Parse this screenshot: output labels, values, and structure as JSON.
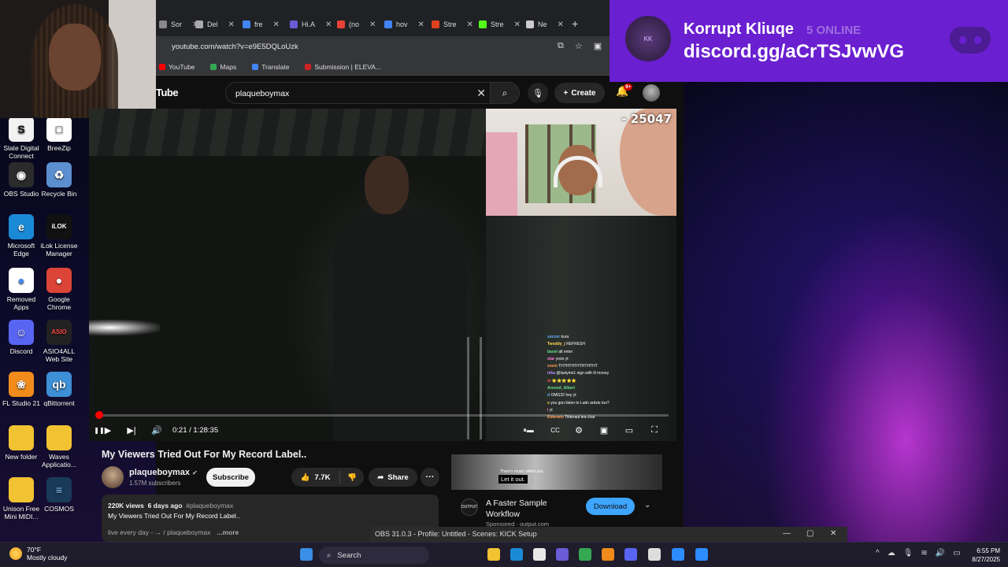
{
  "overlay": {
    "discord_server": "Korrupt Kliuqe",
    "discord_online": "5 ONLINE",
    "discord_link": "discord.gg/aCrTSJvwVG"
  },
  "browser": {
    "tabs": [
      {
        "label": "Sor",
        "color": "#888888"
      },
      {
        "label": "Del",
        "color": "#aaaaaa"
      },
      {
        "label": "fre",
        "color": "#4285f4"
      },
      {
        "label": "Hi.A",
        "color": "#6b5bd6"
      },
      {
        "label": "(no",
        "color": "#ea4335"
      },
      {
        "label": "hov",
        "color": "#4285f4"
      },
      {
        "label": "Stre",
        "color": "#e04020"
      },
      {
        "label": "Stre",
        "color": "#53fc18"
      },
      {
        "label": "Ne",
        "color": "#cccccc"
      }
    ],
    "url": "youtube.com/watch?v=e9E5DQLoUzk",
    "bookmarks": [
      {
        "label": "YouTube",
        "color": "#ff0000"
      },
      {
        "label": "Maps",
        "color": "#34a853"
      },
      {
        "label": "Translate",
        "color": "#4285f4"
      },
      {
        "label": "Submission | ELEVA...",
        "color": "#cc2222"
      }
    ]
  },
  "youtube": {
    "logo": "Tube",
    "search_query": "plaqueboymax",
    "create_label": "Create",
    "notif_count": "9+",
    "stream_counter": "- 25047",
    "time_display": "0:21 / 1:28:35",
    "progress_fraction": 0.004,
    "video_title": "My Viewers Tried Out For My Record Label..",
    "channel_name": "plaqueboymax",
    "subscribers": "1.57M subscribers",
    "subscribe_label": "Subscribe",
    "likes": "7.7K",
    "share_label": "Share",
    "desc_views": "220K views",
    "desc_age": "6 days ago",
    "desc_tag": "#plaqueboymax",
    "desc_line": "My Viewers Tried Out For My Record Label..",
    "desc_more": "...more",
    "desc_trunc": "live every day - → / plaqueboymax",
    "ad_caption_small": "There's music within you.",
    "ad_caption": "Let it out.",
    "ad_title": "A Faster Sample Workflow",
    "ad_sponsored": "Sponsored · output.com",
    "ad_download": "Download",
    "chat": [
      {
        "user": "soccer",
        "msg": "kura",
        "color": "#6ab0ff"
      },
      {
        "user": "Twoddy_j",
        "msg": "REFRESH",
        "color": "#ffd84a"
      },
      {
        "user": "basel",
        "msg": "alt enter",
        "color": "#66e08a"
      },
      {
        "user": "star",
        "msg": "yooo yt",
        "color": "#ff7ad9"
      },
      {
        "user": "zoem",
        "msg": "THTHTHTHTHTHTHT",
        "color": "#ff9a4a"
      },
      {
        "user": "nika",
        "msg": "@lastyms1 sign with lil mooey",
        "color": "#b98cff"
      },
      {
        "user": "m",
        "msg": "⭐⭐⭐⭐⭐",
        "color": "#ff5a5a"
      },
      {
        "user": "Around_Albert",
        "msg": "",
        "color": "#66e08a"
      },
      {
        "user": "d",
        "msg": "OMG32 hey yt",
        "color": "#6ab0ff"
      },
      {
        "user": "s",
        "msg": "you gon listen to Latin artists too?",
        "color": "#ffd84a"
      },
      {
        "user": "i",
        "msg": "yt",
        "color": "#ff7ad9"
      },
      {
        "user": "Elderwin",
        "msg": "Tilderaut lea chat",
        "color": "#ff9a4a"
      }
    ]
  },
  "desktop": {
    "icons": [
      {
        "label": "Slate Digital Connect",
        "glyph": "S",
        "bg": "#f2f2f2",
        "fg": "#111111"
      },
      {
        "label": "BreeZip",
        "glyph": "□",
        "bg": "#ffffff",
        "fg": "#555555"
      },
      {
        "label": "OBS Studio",
        "glyph": "◉",
        "bg": "#2b2b2b",
        "fg": "#ffffff"
      },
      {
        "label": "Recycle Bin",
        "glyph": "♻",
        "bg": "#5b8fd0",
        "fg": "#ffffff"
      },
      {
        "label": "Microsoft Edge",
        "glyph": "e",
        "bg": "#1b8ad6",
        "fg": "#ffffff"
      },
      {
        "label": "iLok License Manager",
        "glyph": "iLOK",
        "bg": "#111111",
        "fg": "#ffffff"
      },
      {
        "label": "Removed Apps",
        "glyph": "●",
        "bg": "#ffffff",
        "fg": "#4285f4"
      },
      {
        "label": "Google Chrome",
        "glyph": "●",
        "bg": "#db4437",
        "fg": "#ffffff"
      },
      {
        "label": "Discord",
        "glyph": "☺",
        "bg": "#5865f2",
        "fg": "#ffffff"
      },
      {
        "label": "ASIO4ALL Web Site",
        "glyph": "ASIO",
        "bg": "#222222",
        "fg": "#ff4444"
      },
      {
        "label": "FL Studio 21",
        "glyph": "❀",
        "bg": "#f08b1c",
        "fg": "#ffffff"
      },
      {
        "label": "qBittorrent",
        "glyph": "qb",
        "bg": "#3d8fd6",
        "fg": "#ffffff"
      },
      {
        "label": "New folder",
        "glyph": "",
        "bg": "#f1c232",
        "fg": "#ffffff"
      },
      {
        "label": "Waves Applicatio...",
        "glyph": "",
        "bg": "#f1c232",
        "fg": "#ffffff"
      },
      {
        "label": "Unison Free Mini MIDI...",
        "glyph": "",
        "bg": "#f1c232",
        "fg": "#ffffff"
      },
      {
        "label": "COSMOS",
        "glyph": "≡",
        "bg": "#1a3a5a",
        "fg": "#8fd0ff"
      }
    ]
  },
  "obs_bar": {
    "title": "OBS 31.0.3 - Profile: Untitled - Scenes: KICK Setup"
  },
  "taskbar": {
    "weather_temp": "70°F",
    "weather_desc": "Mostly cloudy",
    "search_label": "Search",
    "time": "6:55 PM",
    "date": "8/27/2025",
    "pinned": [
      {
        "name": "file-explorer-icon",
        "color": "#f1c232"
      },
      {
        "name": "edge-icon",
        "color": "#1b8ad6"
      },
      {
        "name": "store-icon",
        "color": "#e8e8e8"
      },
      {
        "name": "app-icon",
        "color": "#6b5bd6"
      },
      {
        "name": "chrome-icon",
        "color": "#34a853"
      },
      {
        "name": "fl-studio-icon",
        "color": "#f08b1c"
      },
      {
        "name": "discord-icon",
        "color": "#5865f2"
      },
      {
        "name": "obs-icon",
        "color": "#dddddd"
      },
      {
        "name": "zoom-icon",
        "color": "#2d8cff"
      },
      {
        "name": "vpn-icon",
        "color": "#2d8cff"
      }
    ]
  }
}
